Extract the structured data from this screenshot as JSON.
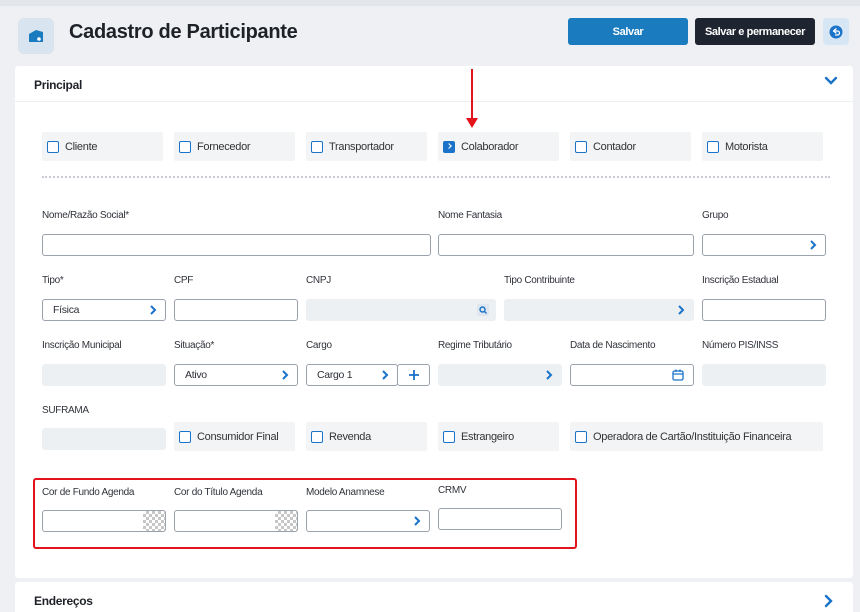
{
  "header": {
    "title": "Cadastro de Participante",
    "save_label": "Salvar",
    "save_stay_label": "Salvar e permanecer"
  },
  "sections": {
    "principal": "Principal",
    "enderecos": "Endereços"
  },
  "checkboxes": [
    {
      "label": "Cliente",
      "checked": false
    },
    {
      "label": "Fornecedor",
      "checked": false
    },
    {
      "label": "Transportador",
      "checked": false
    },
    {
      "label": "Colaborador",
      "checked": true
    },
    {
      "label": "Contador",
      "checked": false
    },
    {
      "label": "Motorista",
      "checked": false
    }
  ],
  "checkboxes2": [
    {
      "label": "Consumidor Final",
      "checked": false
    },
    {
      "label": "Revenda",
      "checked": false
    },
    {
      "label": "Estrangeiro",
      "checked": false
    },
    {
      "label": "Operadora de Cartão/Instituição Financeira",
      "checked": false
    }
  ],
  "fields": {
    "nome_razao": {
      "label": "Nome/Razão Social*",
      "value": ""
    },
    "nome_fantasia": {
      "label": "Nome Fantasia",
      "value": ""
    },
    "grupo": {
      "label": "Grupo",
      "value": ""
    },
    "tipo": {
      "label": "Tipo*",
      "value": "Física"
    },
    "cpf": {
      "label": "CPF",
      "value": ""
    },
    "cnpj": {
      "label": "CNPJ",
      "value": ""
    },
    "tipo_contribuinte": {
      "label": "Tipo Contribuinte",
      "value": ""
    },
    "inscricao_estadual": {
      "label": "Inscrição Estadual",
      "value": ""
    },
    "inscricao_municipal": {
      "label": "Inscrição Municipal",
      "value": ""
    },
    "situacao": {
      "label": "Situação*",
      "value": "Ativo"
    },
    "cargo": {
      "label": "Cargo",
      "value": "Cargo 1"
    },
    "regime_tributario": {
      "label": "Regime Tributário",
      "value": ""
    },
    "data_nascimento": {
      "label": "Data de Nascimento",
      "value": ""
    },
    "numero_pis": {
      "label": "Número PIS/INSS",
      "value": ""
    },
    "suframa": {
      "label": "SUFRAMA",
      "value": ""
    },
    "cor_fundo": {
      "label": "Cor de Fundo Agenda",
      "value": ""
    },
    "cor_titulo": {
      "label": "Cor do Título Agenda",
      "value": ""
    },
    "modelo_anamnese": {
      "label": "Modelo Anamnese",
      "value": ""
    },
    "crmv": {
      "label": "CRMV",
      "value": ""
    }
  },
  "colors": {
    "primary": "#1a7bbf",
    "dark": "#1e2430",
    "annotation": "#e3131b"
  }
}
